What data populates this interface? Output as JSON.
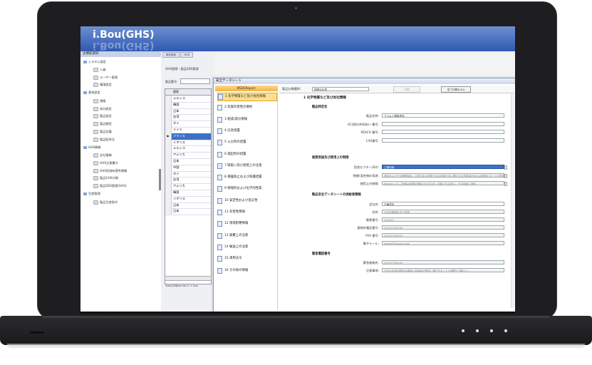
{
  "app": {
    "title": "i.Bou(GHS)"
  },
  "tree": {
    "header": "主機能選択",
    "items": [
      {
        "label": "システム設定",
        "level": 1
      },
      {
        "label": "入員",
        "level": 2
      },
      {
        "label": "ユーザー管理",
        "level": 2
      },
      {
        "label": "権限設定",
        "level": 2
      },
      {
        "label": "基本設定",
        "level": 1
      },
      {
        "label": "規格",
        "level": 2
      },
      {
        "label": "成分設定",
        "level": 2
      },
      {
        "label": "製品設定",
        "level": 2
      },
      {
        "label": "製品類型",
        "level": 2
      },
      {
        "label": "製品定義",
        "level": 2
      },
      {
        "label": "製品配合比",
        "level": 2
      },
      {
        "label": "GHS情報",
        "level": 1
      },
      {
        "label": "会社情報",
        "level": 2
      },
      {
        "label": "GHS注意書き",
        "level": 2
      },
      {
        "label": "GHS危険有害性情報",
        "level": 2
      },
      {
        "label": "製品GHS分類",
        "level": 2
      },
      {
        "label": "製品SDS管理(GHS)",
        "level": 2
      },
      {
        "label": "生産管理",
        "level": 1
      },
      {
        "label": "製品生産指令",
        "level": 2
      }
    ]
  },
  "middle": {
    "tabs": [
      "続計設定",
      "GHS"
    ],
    "heading": "GHS国際・製品SDS管理",
    "product_label": "製品番号:",
    "grid_header": "国家",
    "rows": [
      "メキシコ",
      "韓国",
      "日本",
      "台湾",
      "タイ",
      "ドイツ",
      "フランス",
      "イギリス",
      "メキシコ",
      "アメリカ",
      "日本",
      "中国",
      "タイ",
      "台湾",
      "アメリカ",
      "韓国",
      "イギリス",
      "日本",
      "日本"
    ],
    "selected_index": 6,
    "total": "Total:[36]Row No.3 / 1  Sum"
  },
  "dialog": {
    "title": "安全データシート",
    "menu_header": "MSDSReport",
    "menu_items": [
      "1 化学物質など及び会社情報",
      "2 危険有害性の要約",
      "3 組成/成分情報",
      "4 応急措置",
      "5 火災時の措置",
      "6 漏出時の措置",
      "7 取扱い及び保管上の注意",
      "8 暴露防止および保護措置",
      "9 物理的および化学的性質",
      "10 安定性および反応性",
      "11 有害性情報",
      "12 環境影響情報",
      "13 廃棄上の注意",
      "14 輸送上の注意",
      "15 適用法令",
      "16 その他の情報"
    ],
    "active_menu_index": 0,
    "form": {
      "lang_label": "製品分類選択:",
      "lang_value": "国際対応表",
      "btn_print": "印刷",
      "btn_all_print": "全て印刷(Ctrl)",
      "section_title": "1 化学物質など及び会社情報",
      "sub_product": "製品特定名",
      "fields_product": [
        {
          "label": "製品名称:",
          "value": "アルキド樹脂塗料"
        },
        {
          "label": "EC(欧州共同体)一番号:",
          "value": ""
        },
        {
          "label": "REACH 番号:",
          "value": ""
        },
        {
          "label": "CAS番号:",
          "value": ""
        }
      ],
      "sub_use": "推奨用途及び使用上の制限",
      "fields_use": [
        {
          "label": "用途セクター(SU):",
          "value": "工業利用"
        },
        {
          "label": "物質/混合物の用途:",
          "value": "塗料およびその関連製品。注意がある前提である使用方法に関する注意事項があれば参照することの意味"
        },
        {
          "label": "使用上の制限:",
          "value": "Section 2.3 ご使用は制限が適用されるため、供給される前に、その用途に適合"
        }
      ],
      "sub_supplier": "製品安全データシートの供給者情報",
      "fields_supplier": [
        {
          "label": "会社名:",
          "value": "日華塗料"
        },
        {
          "label": "住所:",
          "value": "北京市朝陽区百子湾路"
        },
        {
          "label": "郵便番号:",
          "value": "100022"
        },
        {
          "label": "連絡先電話番号:",
          "value": "010-87746100"
        },
        {
          "label": "FAX 番号:",
          "value": "010-87746107"
        },
        {
          "label": "電子メール:",
          "value": "admin@xxxxxx.com"
        }
      ],
      "sub_emergency": "緊急電話番号",
      "fields_emergency": [
        {
          "label": "緊急連絡先:",
          "value": "010-87746100"
        },
        {
          "label": "注意事項:",
          "value": "当社は中国の販売は現地に供給者が提供し責任することも視野に可能とい"
        }
      ]
    }
  },
  "colors": {
    "banner": "#2f59b2",
    "selection": "#3c72c6",
    "menu_active": "#ffe08a"
  }
}
